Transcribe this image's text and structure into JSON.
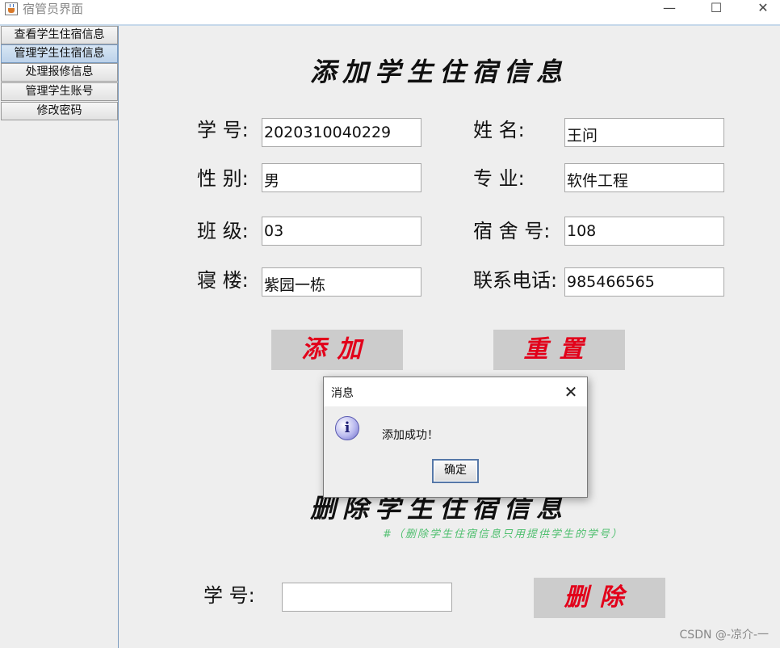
{
  "window": {
    "title": "宿管员界面",
    "controls": {
      "minimize": "—",
      "maximize": "☐",
      "close": "✕"
    }
  },
  "sidebar": {
    "items": [
      {
        "label": "查看学生住宿信息",
        "active": false
      },
      {
        "label": "管理学生住宿信息",
        "active": true
      },
      {
        "label": "处理报修信息",
        "active": false
      },
      {
        "label": "管理学生账号",
        "active": false
      },
      {
        "label": "修改密码",
        "active": false
      }
    ]
  },
  "add_form": {
    "heading": "添加学生住宿信息",
    "fields": {
      "student_id": {
        "label": "学  号:",
        "value": "2020310040229"
      },
      "name": {
        "label": "姓    名:",
        "value": "王问"
      },
      "gender": {
        "label": "性  别:",
        "value": "男"
      },
      "major": {
        "label": "专    业:",
        "value": "软件工程"
      },
      "class": {
        "label": "班  级:",
        "value": "03"
      },
      "dorm_no": {
        "label": "宿 舍 号:",
        "value": "108"
      },
      "building": {
        "label": "寝  楼:",
        "value": "紫园一栋"
      },
      "phone": {
        "label": "联系电话:",
        "value": "985466565"
      }
    },
    "add_button": "添加",
    "reset_button": "重置"
  },
  "delete_form": {
    "heading": "删除学生住宿信息",
    "note": "#（删除学生住宿信息只用提供学生的学号）",
    "student_id_label": "学   号:",
    "student_id_value": "",
    "delete_button": "删除"
  },
  "dialog": {
    "title": "消息",
    "close": "✕",
    "icon": "info-icon",
    "message": "添加成功！",
    "ok_button": "确定"
  },
  "watermark": "CSDN @-凉介-一",
  "colors": {
    "button_text": "#e2001a",
    "note_text": "#4fbf6f",
    "button_bg": "#cccccc",
    "sidebar_border": "#7d9dbf"
  }
}
